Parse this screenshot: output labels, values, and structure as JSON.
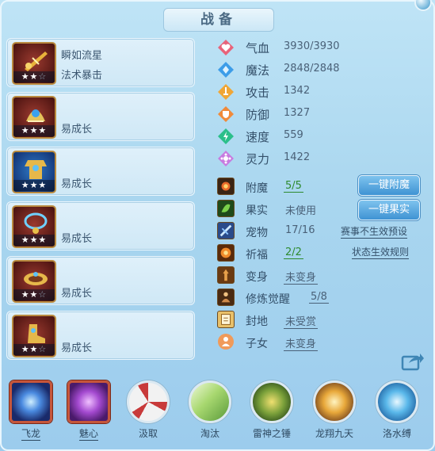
{
  "title": "战备",
  "equipment": [
    {
      "name": "瞬如流星",
      "sub": "法术暴击",
      "stars_on": "★★",
      "stars_off": "☆",
      "icon": "golden-sword-icon",
      "tone": "red"
    },
    {
      "name": "",
      "sub": "易成长",
      "stars_on": "★★★",
      "stars_off": "",
      "icon": "jeweled-helmet-icon",
      "tone": "red"
    },
    {
      "name": "",
      "sub": "易成长",
      "stars_on": "★★★",
      "stars_off": "",
      "icon": "golden-armor-icon",
      "tone": "blue"
    },
    {
      "name": "",
      "sub": "易成长",
      "stars_on": "★★★",
      "stars_off": "",
      "icon": "blue-necklace-icon",
      "tone": "red"
    },
    {
      "name": "",
      "sub": "易成长",
      "stars_on": "★★",
      "stars_off": "☆",
      "icon": "golden-belt-icon",
      "tone": "red"
    },
    {
      "name": "",
      "sub": "易成长",
      "stars_on": "★★",
      "stars_off": "☆",
      "icon": "golden-boots-icon",
      "tone": "red"
    }
  ],
  "stats": [
    {
      "label": "气血",
      "value": "3930/3930",
      "icon": "heart-icon",
      "color": "#e8637a"
    },
    {
      "label": "魔法",
      "value": "2848/2848",
      "icon": "mana-diamond-icon",
      "color": "#3d9de8"
    },
    {
      "label": "攻击",
      "value": "1342",
      "icon": "attack-sword-icon",
      "color": "#f0a636"
    },
    {
      "label": "防御",
      "value": "1327",
      "icon": "defense-shield-icon",
      "color": "#f08a3a"
    },
    {
      "label": "速度",
      "value": "559",
      "icon": "speed-bolt-icon",
      "color": "#2bbf8a"
    },
    {
      "label": "灵力",
      "value": "1422",
      "icon": "spirit-star-icon",
      "color": "#c77be0"
    }
  ],
  "attrs": [
    {
      "label": "附魔",
      "value": "5/5",
      "green": true,
      "icon": "enchant-icon"
    },
    {
      "label": "果实",
      "value": "未使用",
      "green": false,
      "icon": "fruit-icon"
    },
    {
      "label": "宠物",
      "value": "17/16",
      "green": false,
      "icon": "pet-icon"
    },
    {
      "label": "祈福",
      "value": "2/2",
      "green": true,
      "icon": "blessing-icon"
    },
    {
      "label": "变身",
      "value": "未变身",
      "green": false,
      "icon": "transform-icon"
    },
    {
      "label": "修炼觉醒",
      "value": "5/8",
      "green": false,
      "icon": "cultivation-icon"
    },
    {
      "label": "封地",
      "value": "未受赏",
      "green": false,
      "icon": "fief-icon"
    },
    {
      "label": "子女",
      "value": "未变身",
      "green": false,
      "icon": "children-icon"
    }
  ],
  "buttons": {
    "enchant": "一键附魔",
    "fruit": "一键果实"
  },
  "links": {
    "preset": "赛事不生效预设",
    "rules": "状态生效规则"
  },
  "skills": [
    {
      "name": "飞龙",
      "icon": "flying-dragon-icon",
      "shape": "square"
    },
    {
      "name": "魅心",
      "icon": "charm-heart-icon",
      "shape": "square"
    },
    {
      "name": "汲取",
      "icon": "absorb-icon",
      "shape": "round"
    },
    {
      "name": "淘汰",
      "icon": "eliminate-icon",
      "shape": "round"
    },
    {
      "name": "雷神之锤",
      "icon": "thunder-hammer-icon",
      "shape": "round"
    },
    {
      "name": "龙翔九天",
      "icon": "dragon-soar-icon",
      "shape": "round"
    },
    {
      "name": "洛水缚",
      "icon": "water-bind-icon",
      "shape": "round"
    }
  ]
}
